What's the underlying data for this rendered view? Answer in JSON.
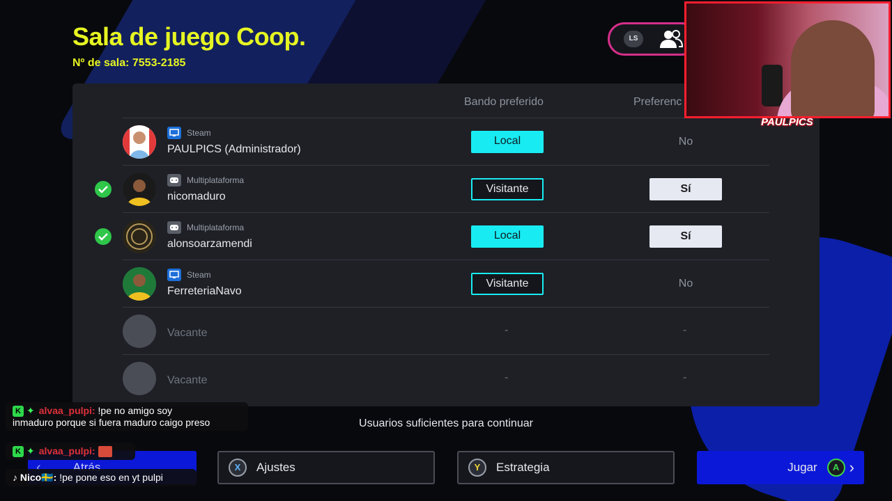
{
  "header": {
    "title": "Sala de juego Coop.",
    "room_number": "Nº de sala: 7553-2185",
    "ls_label": "LS"
  },
  "table": {
    "columns": [
      "Bando preferido",
      "Preferenc"
    ],
    "rows": [
      {
        "platform": "Steam",
        "name": "PAULPICS (Administrador)",
        "ready": false,
        "side": "Local",
        "pref": "No"
      },
      {
        "platform": "Multiplataforma",
        "name": "nicomaduro",
        "ready": true,
        "side": "Visitante",
        "pref": "Sí"
      },
      {
        "platform": "Multiplataforma",
        "name": "alonsoarzamendi",
        "ready": true,
        "side": "Local",
        "pref": "Sí"
      },
      {
        "platform": "Steam",
        "name": "FerreteriaNavo",
        "ready": false,
        "side": "Visitante",
        "pref": "No"
      },
      {
        "name": "Vacante",
        "side": "-",
        "pref": "-"
      },
      {
        "name": "Vacante",
        "side": "-",
        "pref": "-"
      }
    ]
  },
  "footer": {
    "message": "Usuarios suficientes para continuar",
    "back_label": "Atrás",
    "settings_label": "Ajustes",
    "settings_key": "X",
    "strategy_label": "Estrategia",
    "strategy_key": "Y",
    "play_label": "Jugar",
    "play_key": "A"
  },
  "stream": {
    "logo": "PAULPICS",
    "chat": [
      {
        "user": "alvaa_pulpi:",
        "text": "!pe no amigo soy",
        "text2": "inmaduro porque si fuera maduro caigo preso"
      },
      {
        "user": "alvaa_pulpi:",
        "text": ""
      },
      {
        "user": "Nico🇸🇪:",
        "text": "!pe pone eso en yt pulpi"
      }
    ]
  },
  "colors": {
    "accent_yellow": "#e6f521",
    "cyan": "#18ecf2",
    "blue": "#0c18d8",
    "ready_green": "#2fc64a"
  }
}
